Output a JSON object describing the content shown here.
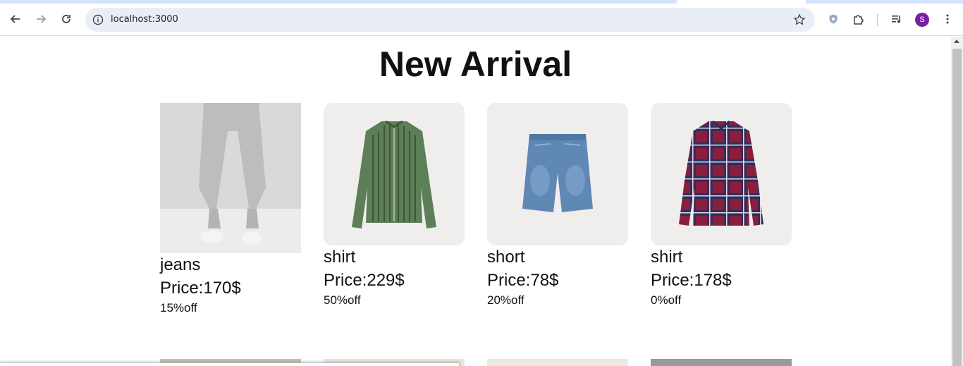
{
  "browser": {
    "url": "localhost:3000",
    "profile_initial": "S"
  },
  "page": {
    "heading": "New Arrival"
  },
  "products": [
    {
      "name": "jeans",
      "price": "Price:170$",
      "discount": "15%off",
      "icon": "grey-joggers"
    },
    {
      "name": "shirt",
      "price": "Price:229$",
      "discount": "50%off",
      "icon": "green-striped-shirt"
    },
    {
      "name": "short",
      "price": "Price:78$",
      "discount": "20%off",
      "icon": "denim-shorts"
    },
    {
      "name": "shirt",
      "price": "Price:178$",
      "discount": "0%off",
      "icon": "plaid-shirt"
    }
  ],
  "colors": {
    "avatar": "#7b1fa2",
    "tab_strip": "#d3e3fd",
    "omnibox": "#e9eef6"
  }
}
